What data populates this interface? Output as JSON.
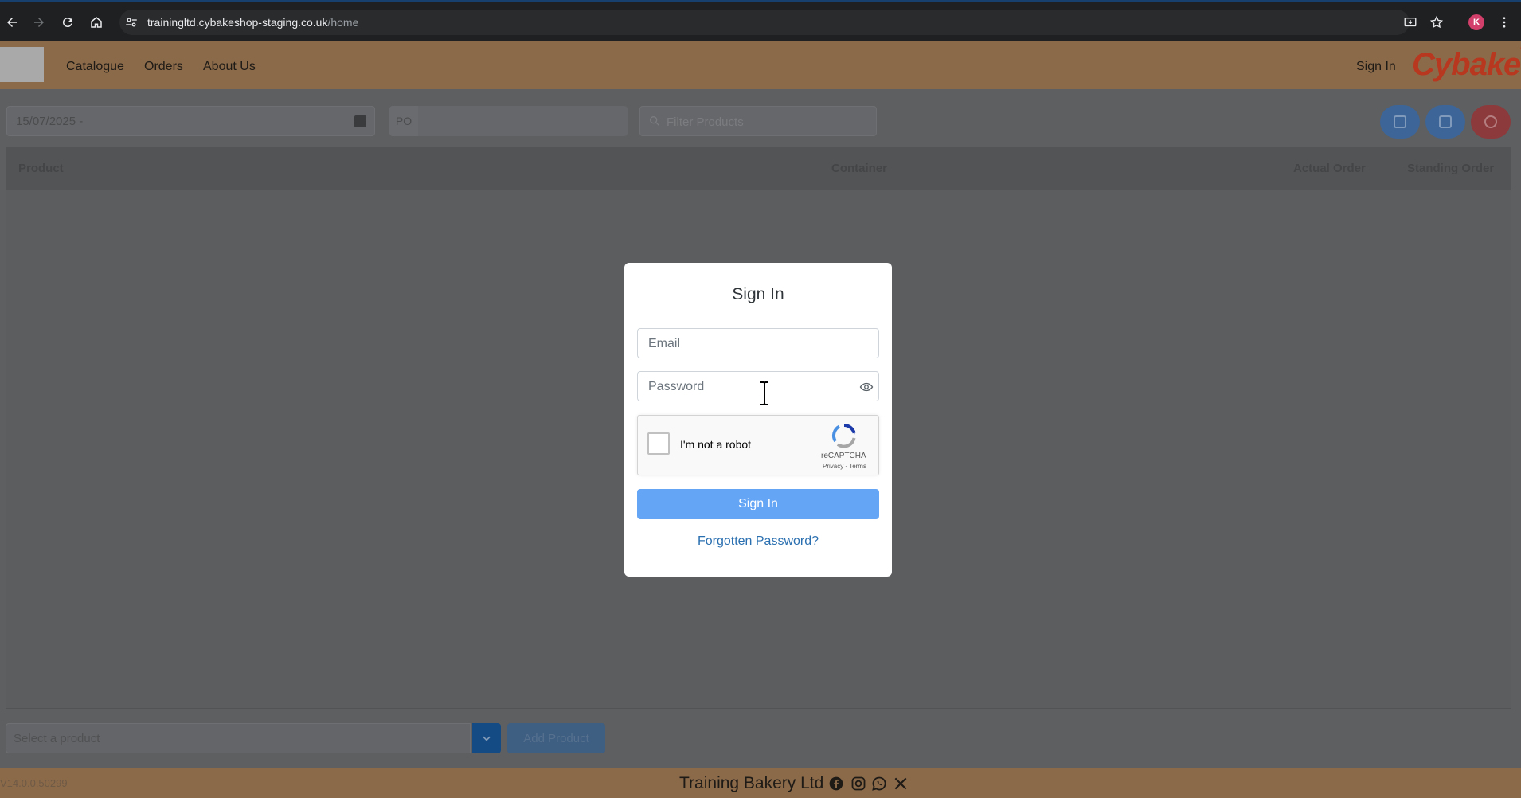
{
  "browser": {
    "url_host": "trainingltd.cybakeshop-staging.co.uk",
    "url_path": "/home",
    "profile_initial": "K"
  },
  "header": {
    "nav": [
      "Catalogue",
      "Orders",
      "About Us"
    ],
    "sign_in": "Sign In",
    "brand": "Cybake",
    "brand_mark": "®"
  },
  "filters": {
    "date": "15/07/2025 -",
    "po_label": "PO",
    "search_placeholder": "Filter Products"
  },
  "table": {
    "columns": [
      "Product",
      "Container",
      "Actual Order",
      "Standing Order"
    ]
  },
  "bottom": {
    "select_placeholder": "Select a product",
    "add_button": "Add Product"
  },
  "footer": {
    "version": "V14.0.0.50299",
    "company": "Training Bakery Ltd"
  },
  "modal": {
    "title": "Sign In",
    "email_placeholder": "Email",
    "password_placeholder": "Password",
    "captcha_label": "I'm not a robot",
    "captcha_brand": "reCAPTCHA",
    "captcha_links": "Privacy - Terms",
    "submit": "Sign In",
    "forgot": "Forgotten Password?"
  },
  "colors": {
    "brand_orange": "#c9a27a",
    "brand_red": "#b8371f",
    "primary_button": "#64a5f5",
    "link": "#2a6fb0"
  }
}
